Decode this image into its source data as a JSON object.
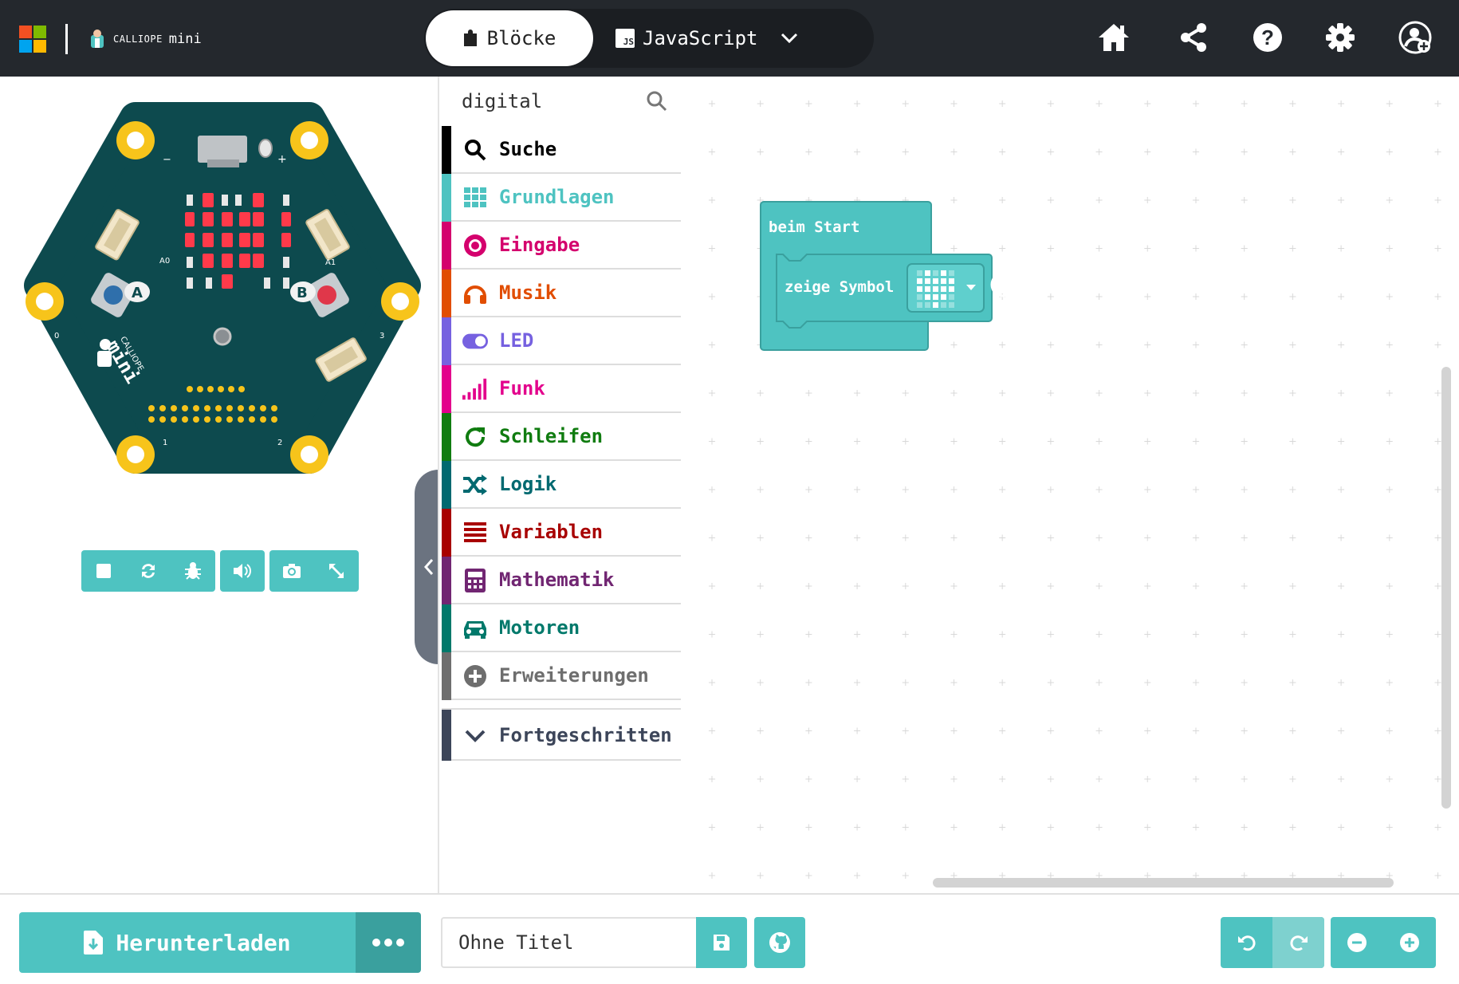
{
  "header": {
    "brand_small": "CALLIOPE",
    "brand_big": "mini",
    "tabs": [
      {
        "label": "Blöcke",
        "active": true
      },
      {
        "label": "JavaScript",
        "active": false
      }
    ],
    "js_badge": "JS",
    "icons": [
      "home-icon",
      "share-icon",
      "help-icon",
      "settings-icon",
      "user-add-icon"
    ]
  },
  "simulator": {
    "board_labels": {
      "a0": "A0",
      "a1": "A1",
      "btn_a": "A",
      "btn_b": "B",
      "pin0": "0",
      "pin1": "1",
      "pin2": "2",
      "pin3": "3",
      "minus": "−",
      "plus": "+",
      "logo_small": "CALLIOPE",
      "logo_big": "mini"
    },
    "controls": [
      "stop-icon",
      "restart-icon",
      "debug-icon",
      "sound-icon",
      "screenshot-icon",
      "fullscreen-icon"
    ]
  },
  "toolbox": {
    "search_value": "digital",
    "categories": [
      {
        "label": "Suche",
        "color": "#000000",
        "text_color": "#000000",
        "icon": "search-icon"
      },
      {
        "label": "Grundlagen",
        "color": "#4ec3c1",
        "text_color": "#4ec3c1",
        "icon": "grid-icon"
      },
      {
        "label": "Eingabe",
        "color": "#d4006d",
        "text_color": "#d4006d",
        "icon": "target-icon"
      },
      {
        "label": "Musik",
        "color": "#e14d00",
        "text_color": "#e14d00",
        "icon": "headphones-icon"
      },
      {
        "label": "LED",
        "color": "#7661e0",
        "text_color": "#7661e0",
        "icon": "toggle-icon"
      },
      {
        "label": "Funk",
        "color": "#e3008c",
        "text_color": "#e3008c",
        "icon": "signal-icon"
      },
      {
        "label": "Schleifen",
        "color": "#107c10",
        "text_color": "#107c10",
        "icon": "refresh-icon"
      },
      {
        "label": "Logik",
        "color": "#006970",
        "text_color": "#006970",
        "icon": "shuffle-icon"
      },
      {
        "label": "Variablen",
        "color": "#a80000",
        "text_color": "#a80000",
        "icon": "list-icon"
      },
      {
        "label": "Mathematik",
        "color": "#712672",
        "text_color": "#712672",
        "icon": "calculator-icon"
      },
      {
        "label": "Motoren",
        "color": "#00796b",
        "text_color": "#00796b",
        "icon": "car-icon"
      },
      {
        "label": "Erweiterungen",
        "color": "#6e6e6e",
        "text_color": "#6e6e6e",
        "icon": "plus-circle-icon"
      }
    ],
    "advanced": {
      "label": "Fortgeschritten",
      "color": "#3c4559",
      "icon": "chevron-down-icon"
    }
  },
  "workspace": {
    "event_block": {
      "label": "beim Start",
      "color": "#4ec3c1"
    },
    "statement_block": {
      "label": "zeige Symbol",
      "field": "heart"
    }
  },
  "bottom": {
    "download_label": "Herunterladen",
    "title_value": "Ohne Titel",
    "title_placeholder": "Ohne Titel"
  }
}
